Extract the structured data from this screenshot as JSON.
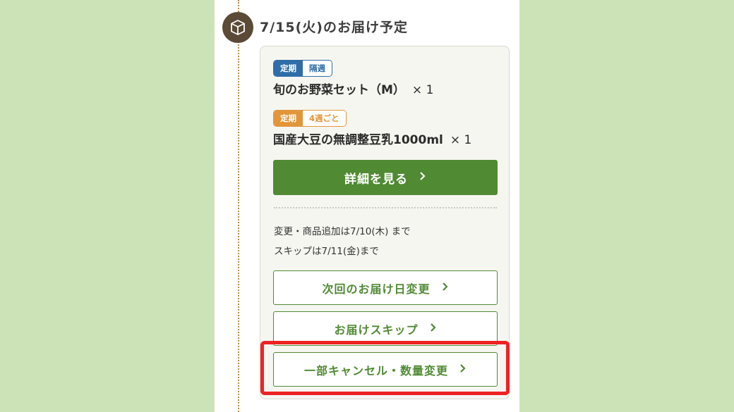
{
  "delivery": {
    "title": "7/15(火)のお届け予定",
    "icon": "package-icon"
  },
  "items": [
    {
      "tag_type": "定期",
      "tag_freq": "隔週",
      "tag_color": "#2e6da8",
      "name": "旬のお野菜セット（M）",
      "qty": "× 1"
    },
    {
      "tag_type": "定期",
      "tag_freq": "4週ごと",
      "tag_color": "#e3953a",
      "name": "国産大豆の無調整豆乳1000ml",
      "qty": "× 1"
    }
  ],
  "detail_button": {
    "label": "詳細を見る",
    "icon": "chevron-right-icon"
  },
  "deadlines": {
    "change": "変更・商品追加は7/10(木) まで",
    "skip": "スキップは7/11(金)まで"
  },
  "actions": {
    "change_date": "次回のお届け日変更",
    "skip": "お届けスキップ",
    "cancel_quantity": "一部キャンセル・数量変更"
  },
  "colors": {
    "background": "#cce3b8",
    "primary_green": "#508a33",
    "highlight_red": "#ee2222"
  }
}
